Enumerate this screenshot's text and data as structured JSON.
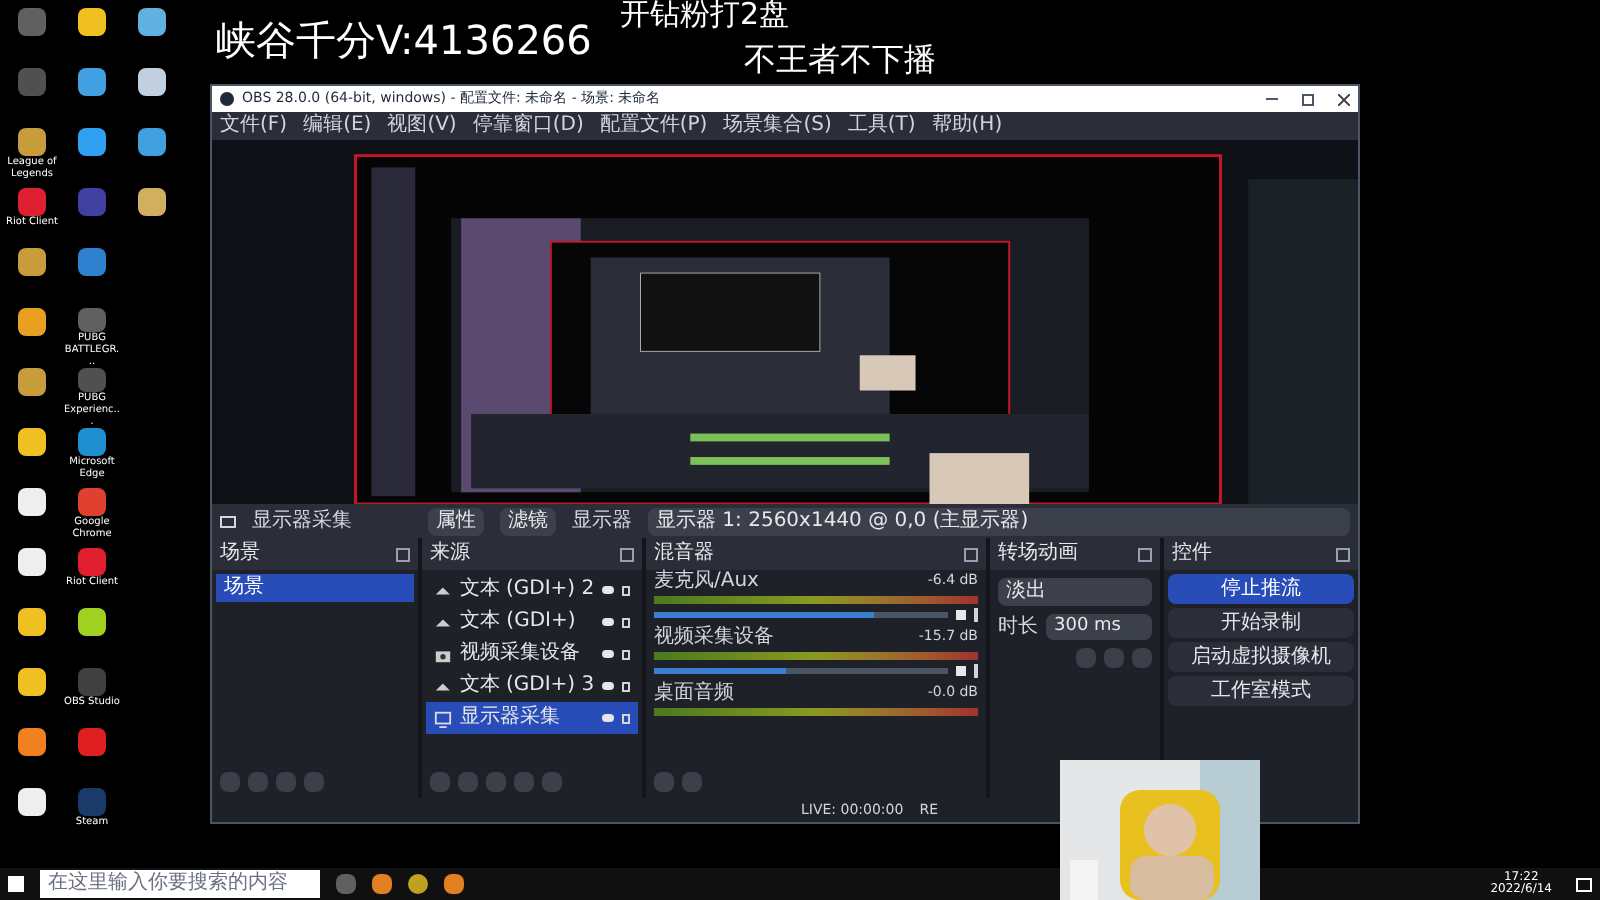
{
  "desktop": {
    "columns": [
      [
        {
          "color": "#606060"
        },
        {
          "color": "#505050"
        },
        {
          "label": "League of Legends",
          "color": "#c89b3c"
        },
        {
          "label": "Riot Client",
          "color": "#e02030"
        },
        {
          "color": "#c89b3c"
        },
        {
          "color": "#e8a020"
        },
        {
          "color": "#c89b3c"
        },
        {
          "color": "#f0c020"
        },
        {
          "color": "#eeeeee"
        },
        {
          "color": "#eeeeee"
        },
        {
          "color": "#f0c020"
        },
        {
          "color": "#f0c020"
        },
        {
          "color": "#f08020"
        },
        {
          "color": "#eeeeee"
        }
      ],
      [
        {
          "color": "#f0c020"
        },
        {
          "color": "#40a0e0"
        },
        {
          "color": "#30a0f0"
        },
        {
          "color": "#4040a0"
        },
        {
          "color": "#3080d0"
        },
        {
          "label": "PUBG BATTLEGR...",
          "color": "#606060"
        },
        {
          "label": "PUBG Experienc...",
          "color": "#505050"
        },
        {
          "label": "Microsoft Edge",
          "color": "#1e90d0"
        },
        {
          "label": "Google Chrome",
          "color": "#e04030"
        },
        {
          "label": "Riot Client",
          "color": "#e02030"
        },
        {
          "color": "#a0d020"
        },
        {
          "label": "OBS Studio",
          "color": "#404040"
        },
        {
          "color": "#e02020"
        },
        {
          "label": "Steam",
          "color": "#1a3a6a"
        }
      ],
      [
        {
          "color": "#60b0e0"
        },
        {
          "color": "#c0d0e0"
        },
        {
          "color": "#40a0e0"
        },
        {
          "color": "#d0b060"
        }
      ]
    ]
  },
  "overlay_texts": [
    "峡谷千分V:4136266",
    "开钻粉打2盘",
    "不王者不下播"
  ],
  "obs": {
    "title": "OBS 28.0.0 (64-bit, windows) - 配置文件: 未命名 - 场景: 未命名",
    "menu": [
      "文件(F)",
      "编辑(E)",
      "视图(V)",
      "停靠窗口(D)",
      "配置文件(P)",
      "场景集合(S)",
      "工具(T)",
      "帮助(H)"
    ],
    "preview": {
      "kind": "picture"
    },
    "source_bar": {
      "source": "显示器采集",
      "properties": "属性",
      "filters": "滤镜",
      "display_label": "显示器",
      "display_value": "显示器 1: 2560x1440 @ 0,0 (主显示器)"
    },
    "scenes": {
      "title": "场景",
      "items": [
        {
          "label": "场景",
          "selected": true
        }
      ]
    },
    "sources": {
      "title": "来源",
      "items": [
        {
          "label": "文本 (GDI+) 2",
          "kind": "text",
          "selected": false
        },
        {
          "label": "文本 (GDI+)",
          "kind": "text",
          "selected": false
        },
        {
          "label": "视频采集设备",
          "kind": "camera",
          "selected": false
        },
        {
          "label": "文本 (GDI+) 3",
          "kind": "text",
          "selected": false
        },
        {
          "label": "显示器采集",
          "kind": "monitor",
          "selected": true
        }
      ]
    },
    "mixer": {
      "title": "混音器",
      "channels": [
        {
          "name": "麦克风/Aux",
          "reading": "-6.4 dB",
          "level": 0.75
        },
        {
          "name": "视频采集设备",
          "reading": "-15.7 dB",
          "level": 0.45
        },
        {
          "name": "桌面音频",
          "reading": "-0.0 dB"
        }
      ]
    },
    "transitions": {
      "title": "转场动画",
      "type": "淡出",
      "duration_label": "时长",
      "duration": "300 ms"
    },
    "controls": {
      "title": "控件",
      "buttons": [
        {
          "label": "停止推流",
          "active": true
        },
        {
          "label": "开始录制",
          "active": false
        },
        {
          "label": "启动虚拟摄像机",
          "active": false
        },
        {
          "label": "工作室模式",
          "active": false
        }
      ]
    },
    "status": {
      "live": "LIVE: 00:00:00",
      "rec": "RE"
    }
  },
  "webcam": {
    "kind": "picture"
  },
  "taskbar": {
    "search_placeholder": "在这里输入你要搜索的内容",
    "time": "17:22",
    "date": "2022/6/14"
  }
}
